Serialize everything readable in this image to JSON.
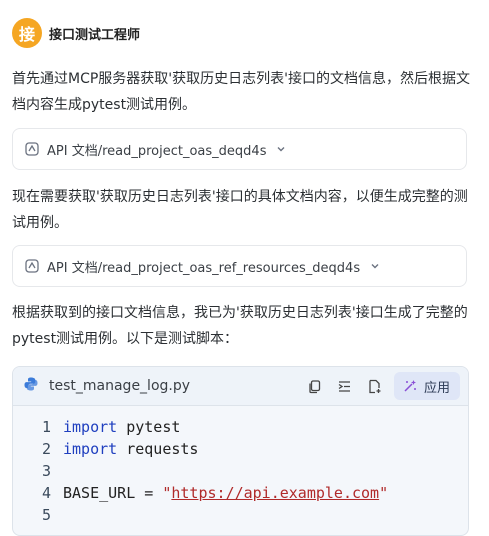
{
  "agent": {
    "avatar_char": "接",
    "name": "接口测试工程师",
    "avatar_color": "#f5a623"
  },
  "messages": [
    "首先通过MCP服务器获取'获取历史日志列表'接口的文档信息，然后根据文档内容生成pytest测试用例。",
    "现在需要获取'获取历史日志列表'接口的具体文档内容，以便生成完整的测试用例。",
    "根据获取到的接口文档信息，我已为'获取历史日志列表'接口生成了完整的pytest测试用例。以下是测试脚本："
  ],
  "tool_calls": [
    {
      "label": "API 文档/read_project_oas_deqd4s",
      "icon": "api-tool-icon"
    },
    {
      "label": "API 文档/read_project_oas_ref_resources_deqd4s",
      "icon": "api-tool-icon"
    }
  ],
  "code": {
    "file_name": "test_manage_log.py",
    "apply_label": "应用",
    "lines": [
      {
        "no": "1",
        "kw": "import",
        "rest": " pytest"
      },
      {
        "no": "2",
        "kw": "import",
        "rest": " requests"
      },
      {
        "no": "3",
        "kw": "",
        "rest": ""
      },
      {
        "no": "4",
        "prefix": "BASE_URL = ",
        "str_open": "\"",
        "url": "https://api.example.com",
        "str_close": "\""
      },
      {
        "no": "5",
        "kw": "",
        "rest": ""
      }
    ]
  },
  "colors": {
    "accent": "#f5a623",
    "keyword": "#1f3fbf",
    "string": "#b02a2a",
    "code_bg": "#f4f7fb"
  }
}
